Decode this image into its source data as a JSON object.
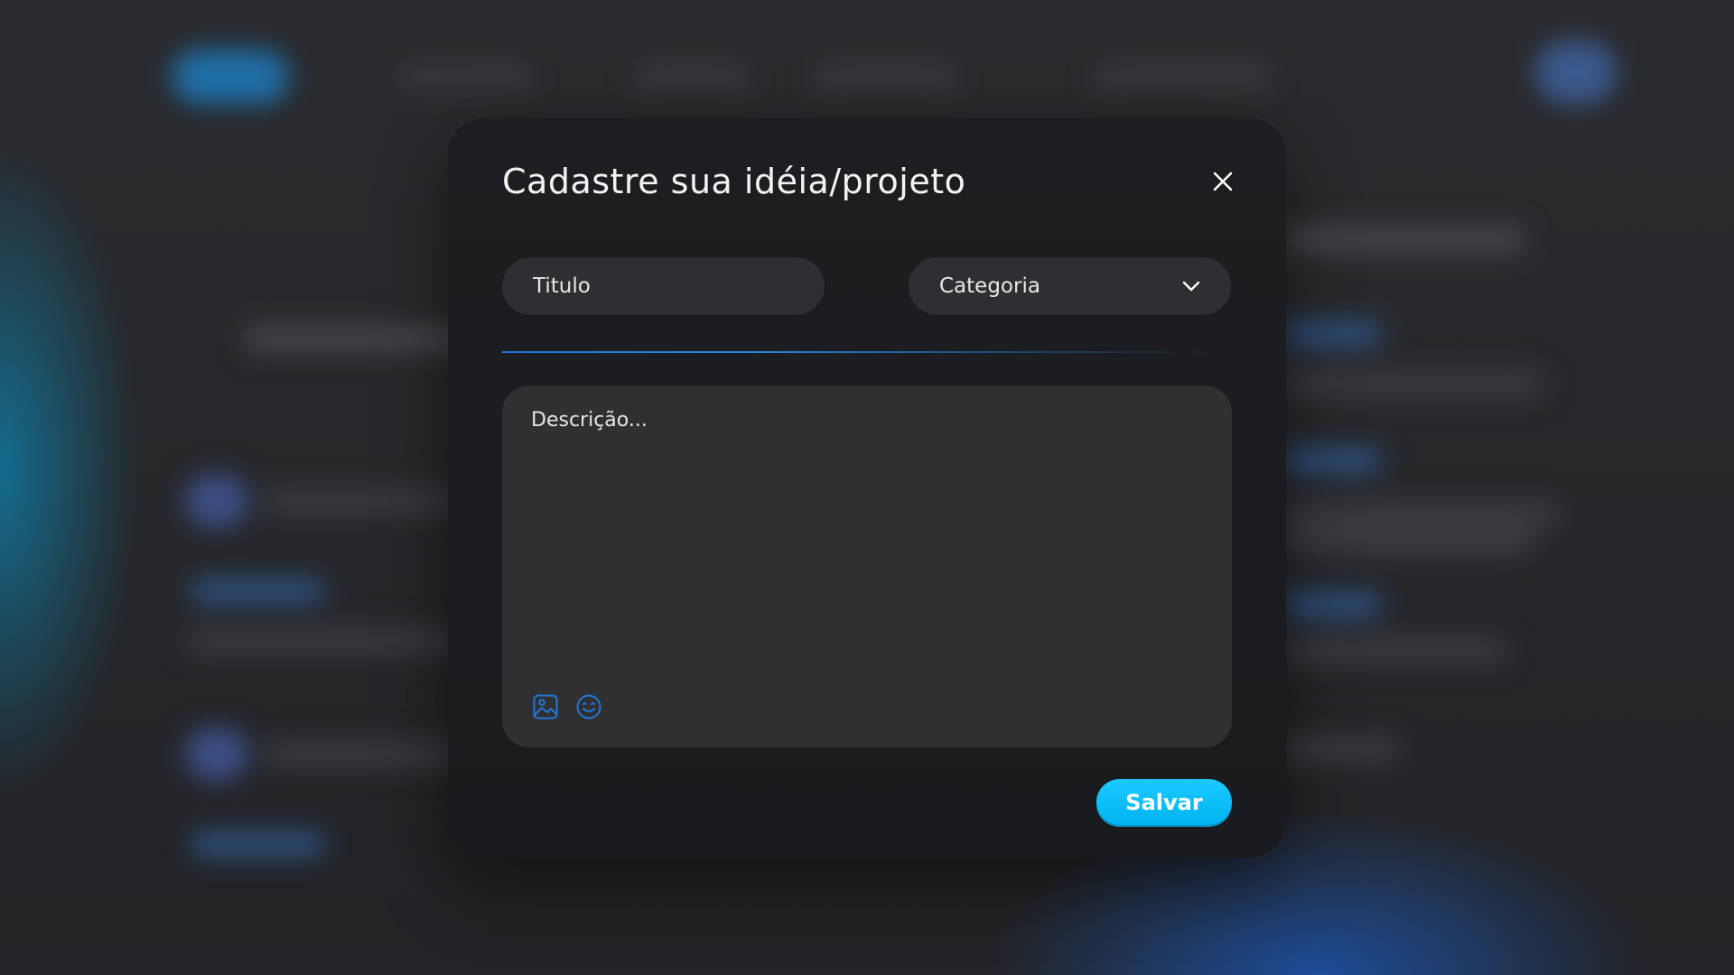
{
  "modal": {
    "title": "Cadastre sua idéia/projeto",
    "close_icon": "close-icon",
    "title_field": {
      "placeholder": "Titulo",
      "value": ""
    },
    "category_select": {
      "selected": "Categoria",
      "icon": "chevron-down-icon"
    },
    "description": {
      "placeholder": "Descrição...",
      "value": ""
    },
    "toolbar": {
      "image_icon": "image-icon",
      "emoji_icon": "emoji-icon"
    },
    "save_label": "Salvar"
  },
  "colors": {
    "accent": "#1ccaff",
    "divider": "#1f78d6",
    "icon": "#1f78d6",
    "modal_bg": "#1d1e21",
    "field_bg": "#2e2f32"
  }
}
